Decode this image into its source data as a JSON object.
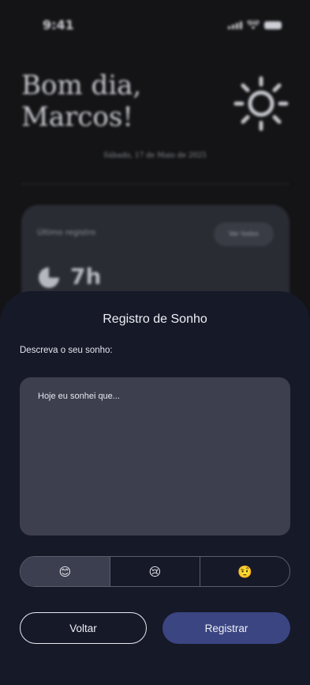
{
  "status_bar": {
    "time": "9:41"
  },
  "home": {
    "greeting_line1": "Bom dia,",
    "greeting_line2": "Marcos!",
    "date": "Sábado, 17 de Maio de 2025",
    "weather_icon": "sun-icon",
    "last_record_card": {
      "label": "Último registro",
      "button_label": "Ver todos",
      "icon": "moon-icon",
      "value": "7h"
    }
  },
  "sheet": {
    "title": "Registro de Sonho",
    "prompt_label": "Descreva o seu sonho:",
    "dream_text": "Hoje eu sonhei que...",
    "moods": [
      {
        "emoji": "😊",
        "icon": "happy-face-icon",
        "selected": true
      },
      {
        "emoji": "😢",
        "icon": "sad-face-icon",
        "selected": false
      },
      {
        "emoji": "🤨",
        "icon": "skeptical-face-icon",
        "selected": false
      }
    ],
    "back_label": "Voltar",
    "save_label": "Registrar"
  },
  "colors": {
    "sheet_bg": "#161928",
    "input_bg": "#3d3f4e",
    "primary_button": "#3b4582"
  }
}
